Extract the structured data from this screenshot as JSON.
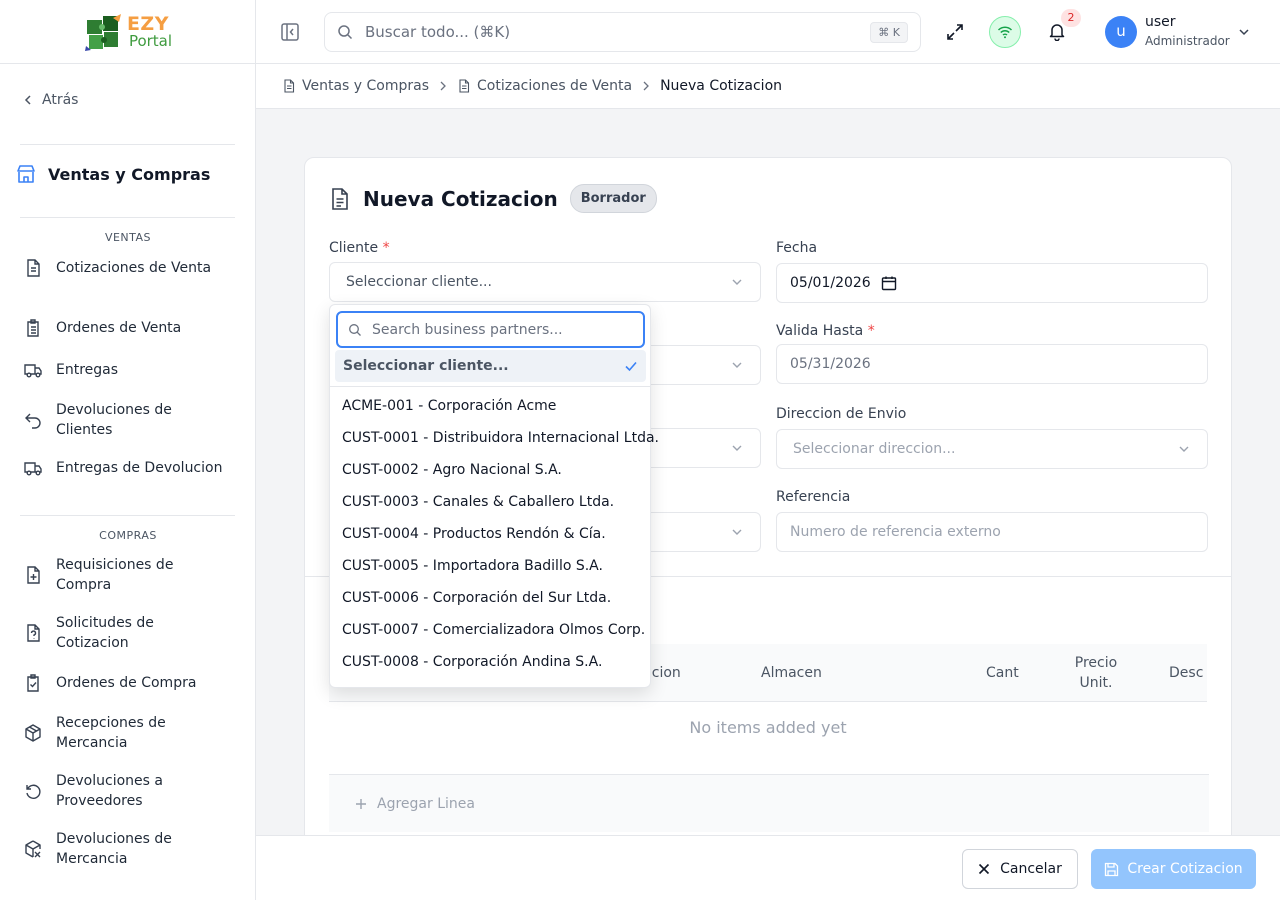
{
  "logo": {
    "text1": "EZY",
    "text2": "Portal"
  },
  "sidebar": {
    "back_label": "Atrás",
    "section_title": "Ventas y Compras",
    "groups": [
      {
        "label": "VENTAS",
        "items": [
          {
            "label": "Cotizaciones de Venta",
            "icon": "document-icon"
          },
          {
            "label": "Ordenes de Venta",
            "icon": "clipboard-list-icon"
          },
          {
            "label": "Entregas",
            "icon": "truck-icon"
          },
          {
            "label": "Devoluciones de Clientes",
            "icon": "undo-icon"
          },
          {
            "label": "Entregas de Devolucion",
            "icon": "truck-return-icon"
          }
        ]
      },
      {
        "label": "COMPRAS",
        "items": [
          {
            "label": "Requisiciones de Compra",
            "icon": "file-plus-icon"
          },
          {
            "label": "Solicitudes de Cotizacion",
            "icon": "file-question-icon"
          },
          {
            "label": "Ordenes de Compra",
            "icon": "clipboard-check-icon"
          },
          {
            "label": "Recepciones de Mercancia",
            "icon": "package-icon"
          },
          {
            "label": "Devoluciones a Proveedores",
            "icon": "rotate-icon"
          },
          {
            "label": "Devoluciones de Mercancia",
            "icon": "package-x-icon"
          }
        ]
      }
    ]
  },
  "topbar": {
    "search_placeholder": "Buscar todo... (⌘K)",
    "search_shortcut": "⌘ K",
    "notification_count": "2",
    "user_initial": "u",
    "user_name": "user",
    "user_role": "Administrador"
  },
  "breadcrumb": [
    "Ventas y Compras",
    "Cotizaciones de Venta",
    "Nueva Cotizacion"
  ],
  "form": {
    "title": "Nueva Cotizacion",
    "status_badge": "Borrador",
    "cliente_label": "Cliente",
    "cliente_placeholder": "Seleccionar cliente...",
    "fecha_label": "Fecha",
    "fecha_value": "05/01/2026",
    "valida_label": "Valida Hasta",
    "valida_value": "05/31/2026",
    "direccion_label": "Direccion de Envio",
    "direccion_placeholder": "Seleccionar direccion...",
    "referencia_label": "Referencia",
    "referencia_placeholder": "Numero de referencia externo",
    "required_mark": "*"
  },
  "table": {
    "headers": [
      "ipcion",
      "Almacen",
      "Cant",
      "Precio Unit.",
      "Desc %"
    ],
    "empty_text": "No items added yet",
    "add_line_label": "Agregar Linea"
  },
  "footer": {
    "cancel_label": "Cancelar",
    "create_label": "Crear Cotizacion"
  },
  "dropdown": {
    "search_placeholder": "Search business partners...",
    "selected_label": "Seleccionar cliente...",
    "options": [
      "ACME-001 - Corporación Acme",
      "CUST-0001 - Distribuidora Internacional Ltda.",
      "CUST-0002 - Agro Nacional S.A.",
      "CUST-0003 - Canales & Caballero Ltda.",
      "CUST-0004 - Productos Rendón & Cía.",
      "CUST-0005 - Importadora Badillo S.A.",
      "CUST-0006 - Corporación del Sur Ltda.",
      "CUST-0007 - Comercializadora Olmos Corp.",
      "CUST-0008 - Corporación Andina S.A."
    ]
  },
  "colors": {
    "accent": "#3b82f6",
    "primary_disabled": "#93c5fd",
    "required": "#ef4444",
    "online": "#16a34a"
  }
}
